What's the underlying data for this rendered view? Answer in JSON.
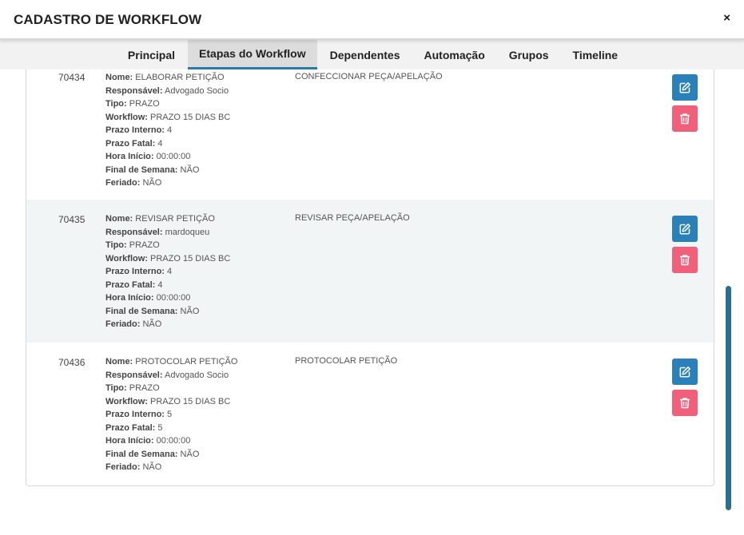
{
  "modal": {
    "title": "CADASTRO DE WORKFLOW",
    "close_label": "×"
  },
  "tabs": [
    {
      "label": "Principal",
      "active": false
    },
    {
      "label": "Etapas do Workflow",
      "active": true
    },
    {
      "label": "Dependentes",
      "active": false
    },
    {
      "label": "Automação",
      "active": false
    },
    {
      "label": "Grupos",
      "active": false
    },
    {
      "label": "Timeline",
      "active": false
    }
  ],
  "field_labels": {
    "nome": "Nome:",
    "responsavel": "Responsável:",
    "tipo": "Tipo:",
    "workflow": "Workflow:",
    "prazo_interno": "Prazo Interno:",
    "prazo_fatal": "Prazo Fatal:",
    "hora_inicio": "Hora Início:",
    "final_semana": "Final de Semana:",
    "feriado": "Feriado:"
  },
  "rows": [
    {
      "id": "70434",
      "nome": "ELABORAR PETIÇÃO",
      "responsavel": "Advogado Socio",
      "tipo": "PRAZO",
      "workflow": "PRAZO 15 DIAS BC",
      "prazo_interno": "4",
      "prazo_fatal": "4",
      "hora_inicio": "00:00:00",
      "final_semana": "NÃO",
      "feriado": "NÃO",
      "descricao": "CONFECCIONAR PEÇA/APELAÇÃO"
    },
    {
      "id": "70435",
      "nome": "REVISAR PETIÇÃO",
      "responsavel": "mardoqueu",
      "tipo": "PRAZO",
      "workflow": "PRAZO 15 DIAS BC",
      "prazo_interno": "4",
      "prazo_fatal": "4",
      "hora_inicio": "00:00:00",
      "final_semana": "NÃO",
      "feriado": "NÃO",
      "descricao": "REVISAR PEÇA/APELAÇÃO"
    },
    {
      "id": "70436",
      "nome": "PROTOCOLAR PETIÇÃO",
      "responsavel": "Advogado Socio",
      "tipo": "PRAZO",
      "workflow": "PRAZO 15 DIAS BC",
      "prazo_interno": "5",
      "prazo_fatal": "5",
      "hora_inicio": "00:00:00",
      "final_semana": "NÃO",
      "feriado": "NÃO",
      "descricao": "PROTOCOLAR PETIÇÃO"
    }
  ],
  "icons": {
    "edit": "edit-icon",
    "delete": "trash-icon",
    "close": "close-icon"
  },
  "colors": {
    "edit_button": "#2a80b9",
    "delete_button": "#f0607a",
    "active_tab_border": "#2a7aa8",
    "scrollbar": "#2a6f8f"
  }
}
